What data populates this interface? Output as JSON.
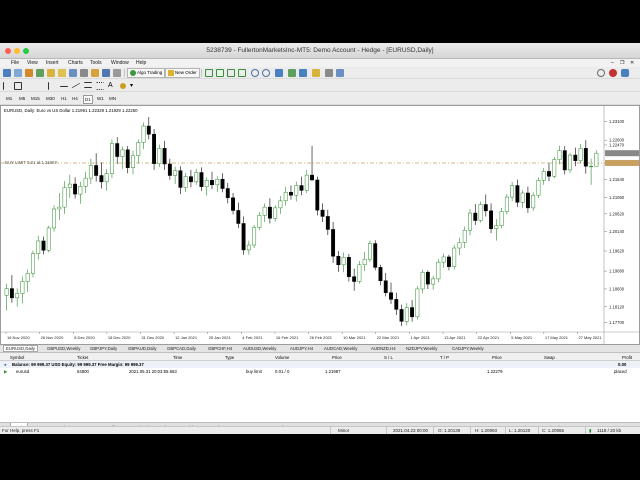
{
  "window": {
    "title": "5238739 - FullertonMarketsInc-MT5: Demo Account - Hedge - [EURUSD,Daily]"
  },
  "menu": [
    "File",
    "View",
    "Insert",
    "Charts",
    "Tools",
    "Window",
    "Help"
  ],
  "toolbar": {
    "algo_trading": "Algo Trading",
    "new_order": "New Order"
  },
  "timeframes": [
    "M1",
    "M5",
    "M15",
    "M30",
    "H1",
    "H4",
    "D1",
    "W1",
    "MN"
  ],
  "active_timeframe": "D1",
  "chart": {
    "info": "EURUSD, Daily:  Euro vs US Dollar  1.21991 1.22329 1.21929 1.22250",
    "order_label": "BUY LIMIT 0.01 at 1.21987",
    "order_price": 1.21987,
    "x_labels": [
      "16 Nov 2020",
      "26 Nov 2020",
      "8 Dec 2020",
      "18 Dec 2020",
      "31 Dec 2020",
      "12 Jan 2021",
      "25 Jan 2021",
      "4 Feb 2021",
      "16 Feb 2021",
      "26 Feb 2021",
      "10 Mar 2021",
      "22 Mar 2021",
      "1 Apr 2021",
      "13 Apr 2021",
      "22 Apr 2021",
      "5 May 2021",
      "17 May 2021",
      "27 May 2021"
    ],
    "y_labels": [
      "1.23100",
      "1.22600",
      "1.22470",
      "1.21970",
      "1.21540",
      "1.21060",
      "1.20620",
      "1.20140",
      "1.19620",
      "1.19080",
      "1.18600",
      "1.18120",
      "1.17700"
    ],
    "y_range": [
      1.1755,
      1.2325
    ],
    "bars": [
      {
        "o": 1.1843,
        "h": 1.1874,
        "l": 1.1802,
        "c": 1.1861
      },
      {
        "o": 1.1861,
        "h": 1.1897,
        "l": 1.1823,
        "c": 1.1836
      },
      {
        "o": 1.1836,
        "h": 1.1862,
        "l": 1.1812,
        "c": 1.1848
      },
      {
        "o": 1.1848,
        "h": 1.1893,
        "l": 1.1821,
        "c": 1.188
      },
      {
        "o": 1.188,
        "h": 1.1912,
        "l": 1.1852,
        "c": 1.1902
      },
      {
        "o": 1.1902,
        "h": 1.1963,
        "l": 1.1891,
        "c": 1.1955
      },
      {
        "o": 1.1955,
        "h": 1.2003,
        "l": 1.1939,
        "c": 1.1989
      },
      {
        "o": 1.1989,
        "h": 1.2001,
        "l": 1.1953,
        "c": 1.1964
      },
      {
        "o": 1.1964,
        "h": 1.203,
        "l": 1.1958,
        "c": 1.2024
      },
      {
        "o": 1.2024,
        "h": 1.2085,
        "l": 1.2014,
        "c": 1.2075
      },
      {
        "o": 1.2075,
        "h": 1.2118,
        "l": 1.2045,
        "c": 1.208
      },
      {
        "o": 1.208,
        "h": 1.215,
        "l": 1.2062,
        "c": 1.2132
      },
      {
        "o": 1.2132,
        "h": 1.2167,
        "l": 1.2105,
        "c": 1.2142
      },
      {
        "o": 1.2142,
        "h": 1.216,
        "l": 1.2103,
        "c": 1.2115
      },
      {
        "o": 1.2115,
        "h": 1.2148,
        "l": 1.2089,
        "c": 1.2136
      },
      {
        "o": 1.2136,
        "h": 1.2175,
        "l": 1.2118,
        "c": 1.2158
      },
      {
        "o": 1.2158,
        "h": 1.221,
        "l": 1.2142,
        "c": 1.2192
      },
      {
        "o": 1.2192,
        "h": 1.2225,
        "l": 1.2149,
        "c": 1.2165
      },
      {
        "o": 1.2165,
        "h": 1.22,
        "l": 1.213,
        "c": 1.2148
      },
      {
        "o": 1.2148,
        "h": 1.2182,
        "l": 1.2124,
        "c": 1.217
      },
      {
        "o": 1.217,
        "h": 1.2262,
        "l": 1.2158,
        "c": 1.2251
      },
      {
        "o": 1.2251,
        "h": 1.2268,
        "l": 1.2196,
        "c": 1.2216
      },
      {
        "o": 1.2216,
        "h": 1.2243,
        "l": 1.2183,
        "c": 1.2234
      },
      {
        "o": 1.2234,
        "h": 1.2244,
        "l": 1.2171,
        "c": 1.2186
      },
      {
        "o": 1.2186,
        "h": 1.2232,
        "l": 1.2168,
        "c": 1.2218
      },
      {
        "o": 1.2218,
        "h": 1.2262,
        "l": 1.2198,
        "c": 1.2254
      },
      {
        "o": 1.2254,
        "h": 1.2308,
        "l": 1.2236,
        "c": 1.2298
      },
      {
        "o": 1.2298,
        "h": 1.2322,
        "l": 1.2262,
        "c": 1.2276
      },
      {
        "o": 1.2276,
        "h": 1.229,
        "l": 1.218,
        "c": 1.2197
      },
      {
        "o": 1.2197,
        "h": 1.2248,
        "l": 1.2188,
        "c": 1.2238
      },
      {
        "o": 1.2238,
        "h": 1.2258,
        "l": 1.218,
        "c": 1.2196
      },
      {
        "o": 1.2196,
        "h": 1.221,
        "l": 1.2154,
        "c": 1.2165
      },
      {
        "o": 1.2165,
        "h": 1.2189,
        "l": 1.2142,
        "c": 1.2178
      },
      {
        "o": 1.2178,
        "h": 1.219,
        "l": 1.2115,
        "c": 1.2133
      },
      {
        "o": 1.2133,
        "h": 1.2172,
        "l": 1.2121,
        "c": 1.2162
      },
      {
        "o": 1.2162,
        "h": 1.218,
        "l": 1.2133,
        "c": 1.2148
      },
      {
        "o": 1.2148,
        "h": 1.2183,
        "l": 1.214,
        "c": 1.2173
      },
      {
        "o": 1.2173,
        "h": 1.2187,
        "l": 1.2123,
        "c": 1.2135
      },
      {
        "o": 1.2135,
        "h": 1.216,
        "l": 1.2111,
        "c": 1.2152
      },
      {
        "o": 1.2152,
        "h": 1.2175,
        "l": 1.2128,
        "c": 1.214
      },
      {
        "o": 1.214,
        "h": 1.2163,
        "l": 1.2121,
        "c": 1.2155
      },
      {
        "o": 1.2155,
        "h": 1.2171,
        "l": 1.212,
        "c": 1.213
      },
      {
        "o": 1.213,
        "h": 1.2145,
        "l": 1.209,
        "c": 1.2105
      },
      {
        "o": 1.2105,
        "h": 1.2118,
        "l": 1.206,
        "c": 1.2071
      },
      {
        "o": 1.2071,
        "h": 1.2092,
        "l": 1.2024,
        "c": 1.2036
      },
      {
        "o": 1.2036,
        "h": 1.2055,
        "l": 1.1952,
        "c": 1.1965
      },
      {
        "o": 1.1965,
        "h": 1.199,
        "l": 1.1952,
        "c": 1.1978
      },
      {
        "o": 1.1978,
        "h": 1.2032,
        "l": 1.197,
        "c": 1.2025
      },
      {
        "o": 1.2025,
        "h": 1.2067,
        "l": 1.2018,
        "c": 1.2058
      },
      {
        "o": 1.2058,
        "h": 1.209,
        "l": 1.204,
        "c": 1.208
      },
      {
        "o": 1.208,
        "h": 1.2104,
        "l": 1.2036,
        "c": 1.205
      },
      {
        "o": 1.205,
        "h": 1.2085,
        "l": 1.2041,
        "c": 1.2078
      },
      {
        "o": 1.2078,
        "h": 1.211,
        "l": 1.2062,
        "c": 1.2097
      },
      {
        "o": 1.2097,
        "h": 1.2135,
        "l": 1.2084,
        "c": 1.212
      },
      {
        "o": 1.212,
        "h": 1.2138,
        "l": 1.21,
        "c": 1.2112
      },
      {
        "o": 1.2112,
        "h": 1.2149,
        "l": 1.2095,
        "c": 1.2138
      },
      {
        "o": 1.2138,
        "h": 1.2162,
        "l": 1.2112,
        "c": 1.2125
      },
      {
        "o": 1.2125,
        "h": 1.218,
        "l": 1.2118,
        "c": 1.2166
      },
      {
        "o": 1.2166,
        "h": 1.2245,
        "l": 1.2151,
        "c": 1.2153
      },
      {
        "o": 1.2153,
        "h": 1.2162,
        "l": 1.2058,
        "c": 1.2072
      },
      {
        "o": 1.2072,
        "h": 1.209,
        "l": 1.204,
        "c": 1.2055
      },
      {
        "o": 1.2055,
        "h": 1.2073,
        "l": 1.2005,
        "c": 1.202
      },
      {
        "o": 1.202,
        "h": 1.204,
        "l": 1.193,
        "c": 1.1948
      },
      {
        "o": 1.1948,
        "h": 1.1962,
        "l": 1.1906,
        "c": 1.1925
      },
      {
        "o": 1.1925,
        "h": 1.1958,
        "l": 1.1905,
        "c": 1.1945
      },
      {
        "o": 1.1945,
        "h": 1.1954,
        "l": 1.188,
        "c": 1.1893
      },
      {
        "o": 1.1893,
        "h": 1.1915,
        "l": 1.1855,
        "c": 1.188
      },
      {
        "o": 1.188,
        "h": 1.1935,
        "l": 1.1874,
        "c": 1.1925
      },
      {
        "o": 1.1925,
        "h": 1.196,
        "l": 1.1908,
        "c": 1.194
      },
      {
        "o": 1.194,
        "h": 1.199,
        "l": 1.1932,
        "c": 1.1982
      },
      {
        "o": 1.1982,
        "h": 1.1991,
        "l": 1.191,
        "c": 1.1918
      },
      {
        "o": 1.1918,
        "h": 1.1925,
        "l": 1.187,
        "c": 1.1882
      },
      {
        "o": 1.1882,
        "h": 1.1903,
        "l": 1.184,
        "c": 1.185
      },
      {
        "o": 1.185,
        "h": 1.1877,
        "l": 1.182,
        "c": 1.1832
      },
      {
        "o": 1.1832,
        "h": 1.185,
        "l": 1.179,
        "c": 1.1805
      },
      {
        "o": 1.1805,
        "h": 1.1818,
        "l": 1.176,
        "c": 1.1773
      },
      {
        "o": 1.1773,
        "h": 1.1822,
        "l": 1.1762,
        "c": 1.181
      },
      {
        "o": 1.181,
        "h": 1.183,
        "l": 1.1772,
        "c": 1.1785
      },
      {
        "o": 1.1785,
        "h": 1.1868,
        "l": 1.1778,
        "c": 1.186
      },
      {
        "o": 1.186,
        "h": 1.1912,
        "l": 1.1848,
        "c": 1.1905
      },
      {
        "o": 1.1905,
        "h": 1.191,
        "l": 1.186,
        "c": 1.1873
      },
      {
        "o": 1.1873,
        "h": 1.1895,
        "l": 1.1858,
        "c": 1.1887
      },
      {
        "o": 1.1887,
        "h": 1.194,
        "l": 1.1878,
        "c": 1.1932
      },
      {
        "o": 1.1932,
        "h": 1.1955,
        "l": 1.1917,
        "c": 1.1946
      },
      {
        "o": 1.1946,
        "h": 1.1952,
        "l": 1.191,
        "c": 1.192
      },
      {
        "o": 1.192,
        "h": 1.1978,
        "l": 1.1912,
        "c": 1.197
      },
      {
        "o": 1.197,
        "h": 1.1998,
        "l": 1.1951,
        "c": 1.1985
      },
      {
        "o": 1.1985,
        "h": 1.2028,
        "l": 1.197,
        "c": 1.2018
      },
      {
        "o": 1.2018,
        "h": 1.2075,
        "l": 1.2004,
        "c": 1.2064
      },
      {
        "o": 1.2064,
        "h": 1.2088,
        "l": 1.2032,
        "c": 1.2044
      },
      {
        "o": 1.2044,
        "h": 1.2095,
        "l": 1.2038,
        "c": 1.2087
      },
      {
        "o": 1.2087,
        "h": 1.2114,
        "l": 1.2055,
        "c": 1.207
      },
      {
        "o": 1.207,
        "h": 1.209,
        "l": 1.201,
        "c": 1.2022
      },
      {
        "o": 1.2022,
        "h": 1.2048,
        "l": 1.199,
        "c": 1.203
      },
      {
        "o": 1.203,
        "h": 1.2078,
        "l": 1.2023,
        "c": 1.2068
      },
      {
        "o": 1.2068,
        "h": 1.2115,
        "l": 1.206,
        "c": 1.2107
      },
      {
        "o": 1.2107,
        "h": 1.2148,
        "l": 1.2096,
        "c": 1.2138
      },
      {
        "o": 1.2138,
        "h": 1.2154,
        "l": 1.208,
        "c": 1.2093
      },
      {
        "o": 1.2093,
        "h": 1.2125,
        "l": 1.2078,
        "c": 1.2118
      },
      {
        "o": 1.2118,
        "h": 1.2135,
        "l": 1.2065,
        "c": 1.2078
      },
      {
        "o": 1.2078,
        "h": 1.212,
        "l": 1.207,
        "c": 1.2112
      },
      {
        "o": 1.2112,
        "h": 1.216,
        "l": 1.2104,
        "c": 1.2152
      },
      {
        "o": 1.2152,
        "h": 1.2185,
        "l": 1.214,
        "c": 1.2176
      },
      {
        "o": 1.2176,
        "h": 1.22,
        "l": 1.215,
        "c": 1.2163
      },
      {
        "o": 1.2163,
        "h": 1.2215,
        "l": 1.2158,
        "c": 1.2208
      },
      {
        "o": 1.2208,
        "h": 1.2245,
        "l": 1.2195,
        "c": 1.2232
      },
      {
        "o": 1.2232,
        "h": 1.2244,
        "l": 1.2168,
        "c": 1.218
      },
      {
        "o": 1.218,
        "h": 1.2225,
        "l": 1.2172,
        "c": 1.222
      },
      {
        "o": 1.222,
        "h": 1.224,
        "l": 1.219,
        "c": 1.2205
      },
      {
        "o": 1.2205,
        "h": 1.225,
        "l": 1.2198,
        "c": 1.2238
      },
      {
        "o": 1.2238,
        "h": 1.226,
        "l": 1.217,
        "c": 1.219
      },
      {
        "o": 1.219,
        "h": 1.221,
        "l": 1.214,
        "c": 1.219
      },
      {
        "o": 1.219,
        "h": 1.2233,
        "l": 1.2192,
        "c": 1.2225
      }
    ]
  },
  "symbol_tabs": [
    "EURUSD,Daily",
    "GBPUSD,Weekly",
    "GBPJPY,Daily",
    "GBPAUD,Daily",
    "GBPCAD,Daily",
    "GBPCHF,H4",
    "AUDUSD,Weekly",
    "AUDJPY,H4",
    "AUDCAD,Weekly",
    "AUDNZD,H4",
    "NZDJPY,Weekly",
    "CADJPY,Weekly"
  ],
  "terminal": {
    "columns": [
      "Symbol",
      "Ticket",
      "Time",
      "Type",
      "Volume",
      "Price",
      "S / L",
      "T / P",
      "Price",
      "Swap",
      "Profit"
    ],
    "balance_line": "Balance: 99 999.37 USD  Equity: 99 999.37  Free Margin: 99 999.37",
    "balance_profit": "0.00",
    "order": {
      "symbol": "eurusd",
      "ticket": "64800",
      "time": "2021.05.31 20:03:55.653",
      "type": "buy limit",
      "volume": "0.01 / 0",
      "price": "1.21987",
      "current_price": "1.22279",
      "status": "placed"
    }
  },
  "bottom_tabs": [
    "Trade",
    "Exposure",
    "History",
    "News",
    "Mailbox",
    "Calendar",
    "Alerts",
    "Articles",
    "Code Base",
    "Experts",
    "Journal"
  ],
  "bottom_tabs_right": [
    "Market",
    "Signals",
    "VPS",
    "Strategy Tester"
  ],
  "status": {
    "help": "For Help, press F1",
    "profile": "Minor",
    "datetime": "2021.04.23 00:00",
    "open": "O: 1.20139",
    "high": "H: 1.20993",
    "low": "L: 1.20120",
    "close": "C: 1.20965",
    "traffic": "1118 / 20 kb"
  },
  "colors": {
    "bull": "#2e8b2e",
    "bear": "#000000",
    "order_line": "#c8a060",
    "bull_body": "#ffffff"
  }
}
